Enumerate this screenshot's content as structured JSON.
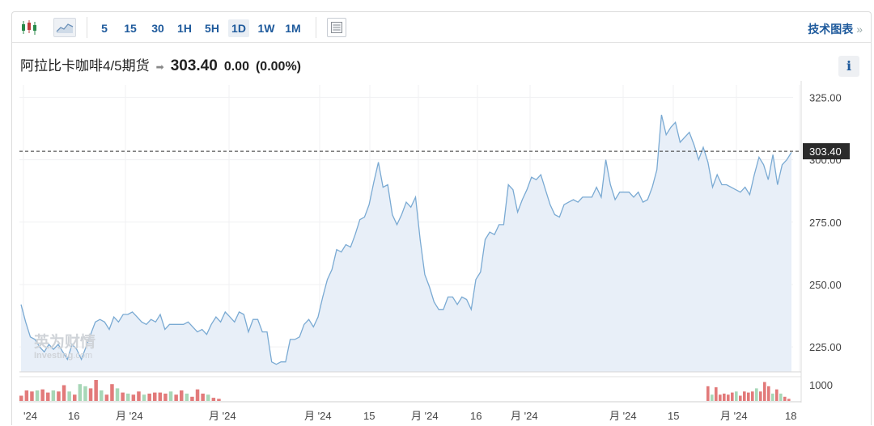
{
  "toolbar": {
    "timeframes": [
      "5",
      "15",
      "30",
      "1H",
      "5H",
      "1D",
      "1W",
      "1M"
    ],
    "active": "1D",
    "tech_chart_label": "技术图表",
    "tech_chart_chevron": "»"
  },
  "header": {
    "name": "阿拉比卡咖啡4/5期货",
    "arrow": "➡",
    "price": "303.40",
    "change": "0.00",
    "change_pct": "(0.00%)",
    "info_label": "i"
  },
  "watermark": {
    "cn": "英为财情",
    "en_a": "Investing",
    "en_b": ".com"
  },
  "chart_data": {
    "type": "area",
    "y_ticks": [
      "325.00",
      "300.00",
      "275.00",
      "250.00",
      "225.00"
    ],
    "ylim": [
      215,
      330
    ],
    "current_price_label": "303.40",
    "current_price": 303.4,
    "volume_tick_label": "1000",
    "x_tick_labels": [
      "'24",
      "16",
      "月 '24",
      "月 '24",
      "月 '24",
      "15",
      "月 '24",
      "16",
      "月 '24",
      "月 '24",
      "15",
      "月 '24",
      "18"
    ],
    "colors": {
      "line": "#7aaad3",
      "fill": "#e8eff8",
      "vol_up": "#a7d7b7",
      "vol_down": "#e27a7a"
    },
    "values": [
      242,
      235,
      229,
      228,
      225,
      223,
      226,
      224,
      226,
      223,
      220,
      226,
      224,
      220,
      225,
      230,
      235,
      236,
      235,
      232,
      237,
      235,
      238,
      238,
      239,
      237,
      235,
      234,
      236,
      235,
      238,
      232,
      234,
      234,
      234,
      234,
      235,
      233,
      231,
      232,
      230,
      234,
      237,
      235,
      239,
      237,
      235,
      239,
      238,
      231,
      236,
      236,
      231,
      231,
      219,
      218,
      219,
      219,
      228,
      228,
      229,
      234,
      236,
      233,
      237,
      245,
      252,
      256,
      264,
      263,
      266,
      265,
      270,
      276,
      277,
      282,
      291,
      299,
      289,
      290,
      278,
      274,
      278,
      283,
      281,
      285,
      268,
      254,
      249,
      243,
      240,
      240,
      245,
      245,
      242,
      245,
      244,
      240,
      252,
      255,
      268,
      271,
      270,
      274,
      274,
      290,
      288,
      279,
      284,
      288,
      293,
      292,
      294,
      288,
      282,
      278,
      277,
      282,
      283,
      284,
      283,
      285,
      285,
      285,
      289,
      285,
      300,
      290,
      284,
      287,
      287,
      287,
      285,
      287,
      283,
      284,
      289,
      296,
      318,
      310,
      313,
      315,
      307,
      309,
      311,
      306,
      300,
      305,
      299,
      289,
      294,
      290,
      290,
      289,
      288,
      287,
      289,
      286,
      294,
      301,
      298,
      292,
      302,
      290,
      298,
      300,
      303
    ],
    "volume": [
      {
        "v": 0.25,
        "up": false
      },
      {
        "v": 0.5,
        "up": false
      },
      {
        "v": 0.45,
        "up": false
      },
      {
        "v": 0.5,
        "up": true
      },
      {
        "v": 0.55,
        "up": false
      },
      {
        "v": 0.4,
        "up": false
      },
      {
        "v": 0.5,
        "up": true
      },
      {
        "v": 0.45,
        "up": false
      },
      {
        "v": 0.75,
        "up": false
      },
      {
        "v": 0.45,
        "up": true
      },
      {
        "v": 0.3,
        "up": false
      },
      {
        "v": 0.8,
        "up": true
      },
      {
        "v": 0.7,
        "up": true
      },
      {
        "v": 0.6,
        "up": false
      },
      {
        "v": 1.0,
        "up": false
      },
      {
        "v": 0.5,
        "up": true
      },
      {
        "v": 0.3,
        "up": false
      },
      {
        "v": 0.8,
        "up": false
      },
      {
        "v": 0.6,
        "up": true
      },
      {
        "v": 0.4,
        "up": false
      },
      {
        "v": 0.35,
        "up": true
      },
      {
        "v": 0.3,
        "up": false
      },
      {
        "v": 0.45,
        "up": false
      },
      {
        "v": 0.3,
        "up": true
      },
      {
        "v": 0.35,
        "up": false
      },
      {
        "v": 0.4,
        "up": false
      },
      {
        "v": 0.4,
        "up": false
      },
      {
        "v": 0.35,
        "up": false
      },
      {
        "v": 0.45,
        "up": true
      },
      {
        "v": 0.3,
        "up": false
      },
      {
        "v": 0.5,
        "up": false
      },
      {
        "v": 0.35,
        "up": true
      },
      {
        "v": 0.2,
        "up": false
      },
      {
        "v": 0.55,
        "up": false
      },
      {
        "v": 0.35,
        "up": false
      },
      {
        "v": 0.3,
        "up": true
      },
      {
        "v": 0.15,
        "up": false
      },
      {
        "v": 0.1,
        "up": false
      }
    ],
    "volume_right": [
      {
        "v": 0.7,
        "up": false
      },
      {
        "v": 0.3,
        "up": true
      },
      {
        "v": 0.65,
        "up": false
      },
      {
        "v": 0.3,
        "up": false
      },
      {
        "v": 0.35,
        "up": false
      },
      {
        "v": 0.3,
        "up": false
      },
      {
        "v": 0.4,
        "up": false
      },
      {
        "v": 0.45,
        "up": true
      },
      {
        "v": 0.25,
        "up": false
      },
      {
        "v": 0.45,
        "up": false
      },
      {
        "v": 0.4,
        "up": false
      },
      {
        "v": 0.45,
        "up": false
      },
      {
        "v": 0.6,
        "up": true
      },
      {
        "v": 0.45,
        "up": false
      },
      {
        "v": 0.9,
        "up": false
      },
      {
        "v": 0.7,
        "up": false
      },
      {
        "v": 0.35,
        "up": true
      },
      {
        "v": 0.55,
        "up": false
      },
      {
        "v": 0.35,
        "up": true
      },
      {
        "v": 0.2,
        "up": false
      },
      {
        "v": 0.1,
        "up": false
      }
    ]
  }
}
